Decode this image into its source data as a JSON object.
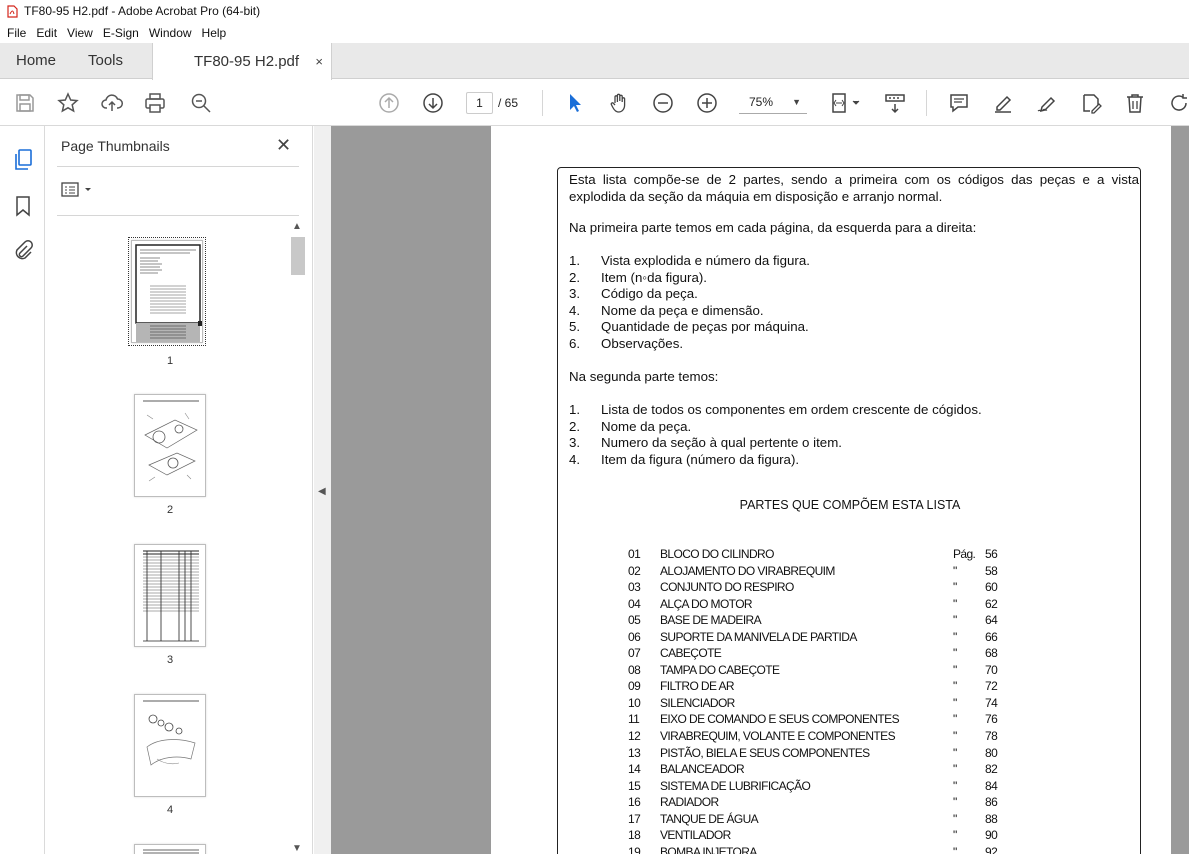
{
  "window": {
    "title": "TF80-95 H2.pdf - Adobe Acrobat Pro (64-bit)"
  },
  "menu": [
    "File",
    "Edit",
    "View",
    "E-Sign",
    "Window",
    "Help"
  ],
  "tabs": {
    "home": "Home",
    "tools": "Tools",
    "document": "TF80-95 H2.pdf",
    "close": "×"
  },
  "toolbar": {
    "current_page": "1",
    "page_total": "/ 65",
    "zoom": "75%"
  },
  "thumbnails": {
    "header": "Page Thumbnails",
    "close": "✕",
    "pages": [
      "1",
      "2",
      "3",
      "4"
    ]
  },
  "document": {
    "intro": "Esta lista compõe-se de 2 partes, sendo a primeira com os códigos das peças e a vista explodida da seção da máquia em disposição e arranjo normal.",
    "first_part_heading": "Na primeira parte temos em cada página, da esquerda para a direita:",
    "first_part_items": [
      {
        "n": "1.",
        "text": "Vista explodida e número da figura."
      },
      {
        "n": "2.",
        "text": "Item (n◦da figura)."
      },
      {
        "n": "3.",
        "text": "Código da peça."
      },
      {
        "n": "4.",
        "text": "Nome da peça e dimensão."
      },
      {
        "n": "5.",
        "text": "Quantidade de peças por máquina."
      },
      {
        "n": "6.",
        "text": "Observações."
      }
    ],
    "second_part_heading": "Na segunda parte temos:",
    "second_part_items": [
      {
        "n": "1.",
        "text": "Lista de todos os componentes em ordem crescente de cógidos."
      },
      {
        "n": "2.",
        "text": "Nome da peça."
      },
      {
        "n": "3.",
        "text": "Numero da seção à qual pertente o item."
      },
      {
        "n": "4.",
        "text": "Item da figura (número da figura)."
      }
    ],
    "parts_title": "PARTES QUE COMPÕEM ESTA LISTA",
    "parts": [
      {
        "code": "01",
        "name": "BLOCO DO CILINDRO",
        "pg": "Pág.",
        "num": "56"
      },
      {
        "code": "02",
        "name": "ALOJAMENTO DO VIRABREQUIM",
        "pg": "\"",
        "num": "58"
      },
      {
        "code": "03",
        "name": "CONJUNTO DO RESPIRO",
        "pg": "\"",
        "num": "60"
      },
      {
        "code": "04",
        "name": "ALÇA DO MOTOR",
        "pg": "\"",
        "num": "62"
      },
      {
        "code": "05",
        "name": "BASE DE MADEIRA",
        "pg": "\"",
        "num": "64"
      },
      {
        "code": "06",
        "name": "SUPORTE DA MANIVELA DE PARTIDA",
        "pg": "\"",
        "num": "66"
      },
      {
        "code": "07",
        "name": "CABEÇOTE",
        "pg": "\"",
        "num": "68"
      },
      {
        "code": "08",
        "name": "TAMPA DO CABEÇOTE",
        "pg": "\"",
        "num": "70"
      },
      {
        "code": "09",
        "name": "FILTRO DE AR",
        "pg": "\"",
        "num": "72"
      },
      {
        "code": "10",
        "name": "SILENCIADOR",
        "pg": "\"",
        "num": "74"
      },
      {
        "code": "11",
        "name": "EIXO DE COMANDO E SEUS COMPONENTES",
        "pg": "\"",
        "num": "76"
      },
      {
        "code": "12",
        "name": "VIRABREQUIM, VOLANTE E COMPONENTES",
        "pg": "\"",
        "num": "78"
      },
      {
        "code": "13",
        "name": "PISTÃO, BIELA E SEUS COMPONENTES",
        "pg": "\"",
        "num": "80"
      },
      {
        "code": "14",
        "name": "BALANCEADOR",
        "pg": "\"",
        "num": "82"
      },
      {
        "code": "15",
        "name": "SISTEMA DE LUBRIFICAÇÃO",
        "pg": "\"",
        "num": "84"
      },
      {
        "code": "16",
        "name": "RADIADOR",
        "pg": "\"",
        "num": "86"
      },
      {
        "code": "17",
        "name": "TANQUE DE ÁGUA",
        "pg": "\"",
        "num": "88"
      },
      {
        "code": "18",
        "name": "VENTILADOR",
        "pg": "\"",
        "num": "90"
      },
      {
        "code": "19",
        "name": "BOMBA INJETORA",
        "pg": "\"",
        "num": "92"
      }
    ]
  }
}
